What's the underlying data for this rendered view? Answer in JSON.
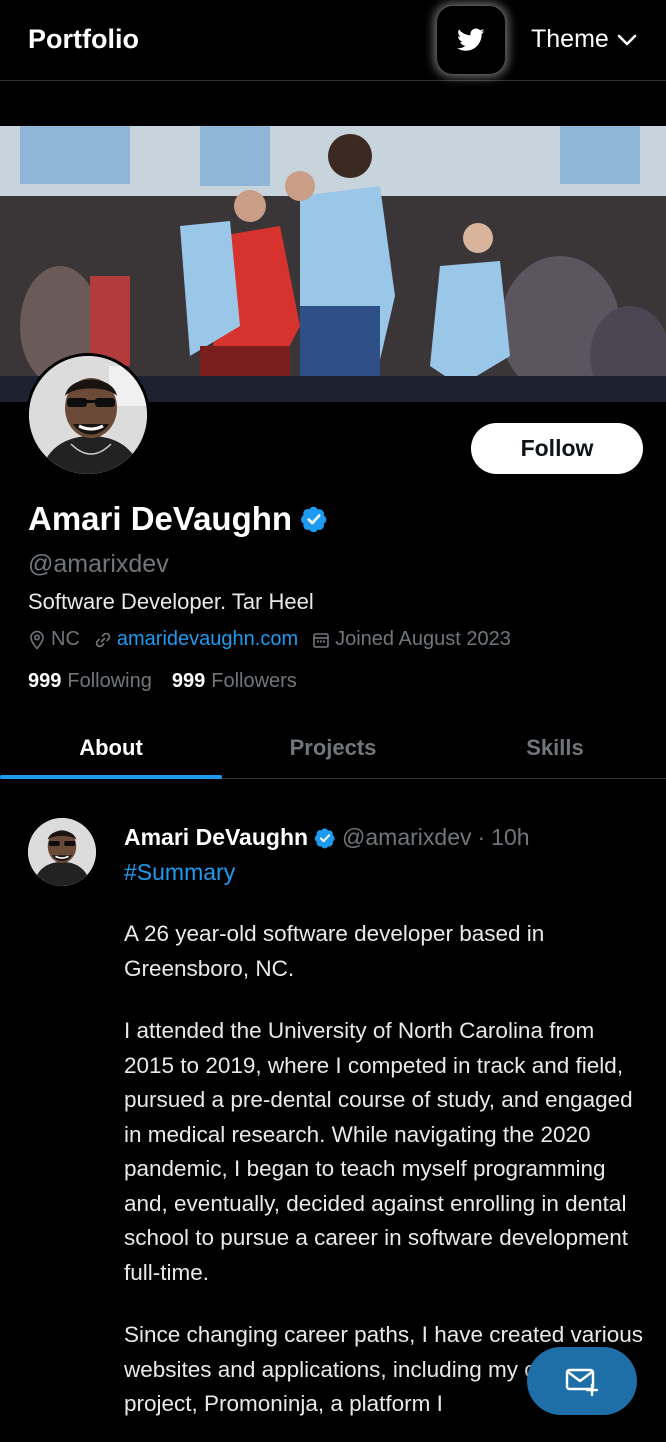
{
  "header": {
    "brand": "Portfolio",
    "theme_label": "Theme"
  },
  "profile": {
    "follow_label": "Follow",
    "name": "Amari DeVaughn",
    "handle": "@amarixdev",
    "bio": "Software Developer. Tar Heel",
    "location": "NC",
    "website": "amaridevaughn.com",
    "joined": "Joined August 2023",
    "following_count": "999",
    "following_label": "Following",
    "followers_count": "999",
    "followers_label": "Followers"
  },
  "tabs": [
    {
      "label": "About",
      "active": true
    },
    {
      "label": "Projects",
      "active": false
    },
    {
      "label": "Skills",
      "active": false
    }
  ],
  "post": {
    "name": "Amari DeVaughn",
    "handle": "@amarixdev",
    "separator": "·",
    "time": "10h",
    "hashtag": "#Summary",
    "paragraphs": [
      "A 26 year-old software developer based in Greensboro, NC.",
      "I attended the University of North Carolina from 2015 to 2019, where I competed in track and field, pursued a pre-dental course of study, and engaged in medical research. While navigating the 2020 pandemic, I began to teach myself programming and, eventually, decided against enrolling in dental school to pursue a career in software development full-time.",
      "Since changing career paths, I have created various websites and applications, including my capstone project, Promoninja, a platform I"
    ]
  },
  "colors": {
    "accent": "#1d9bf0",
    "background": "#000000",
    "muted": "#71767b",
    "fab": "#1e6fa8"
  },
  "icons": {
    "twitter": "twitter-bird-icon",
    "theme": "chevron-down-icon",
    "verified": "verified-badge-icon",
    "location": "location-pin-icon",
    "link": "link-icon",
    "calendar": "calendar-icon",
    "fab": "mail-plus-icon"
  }
}
